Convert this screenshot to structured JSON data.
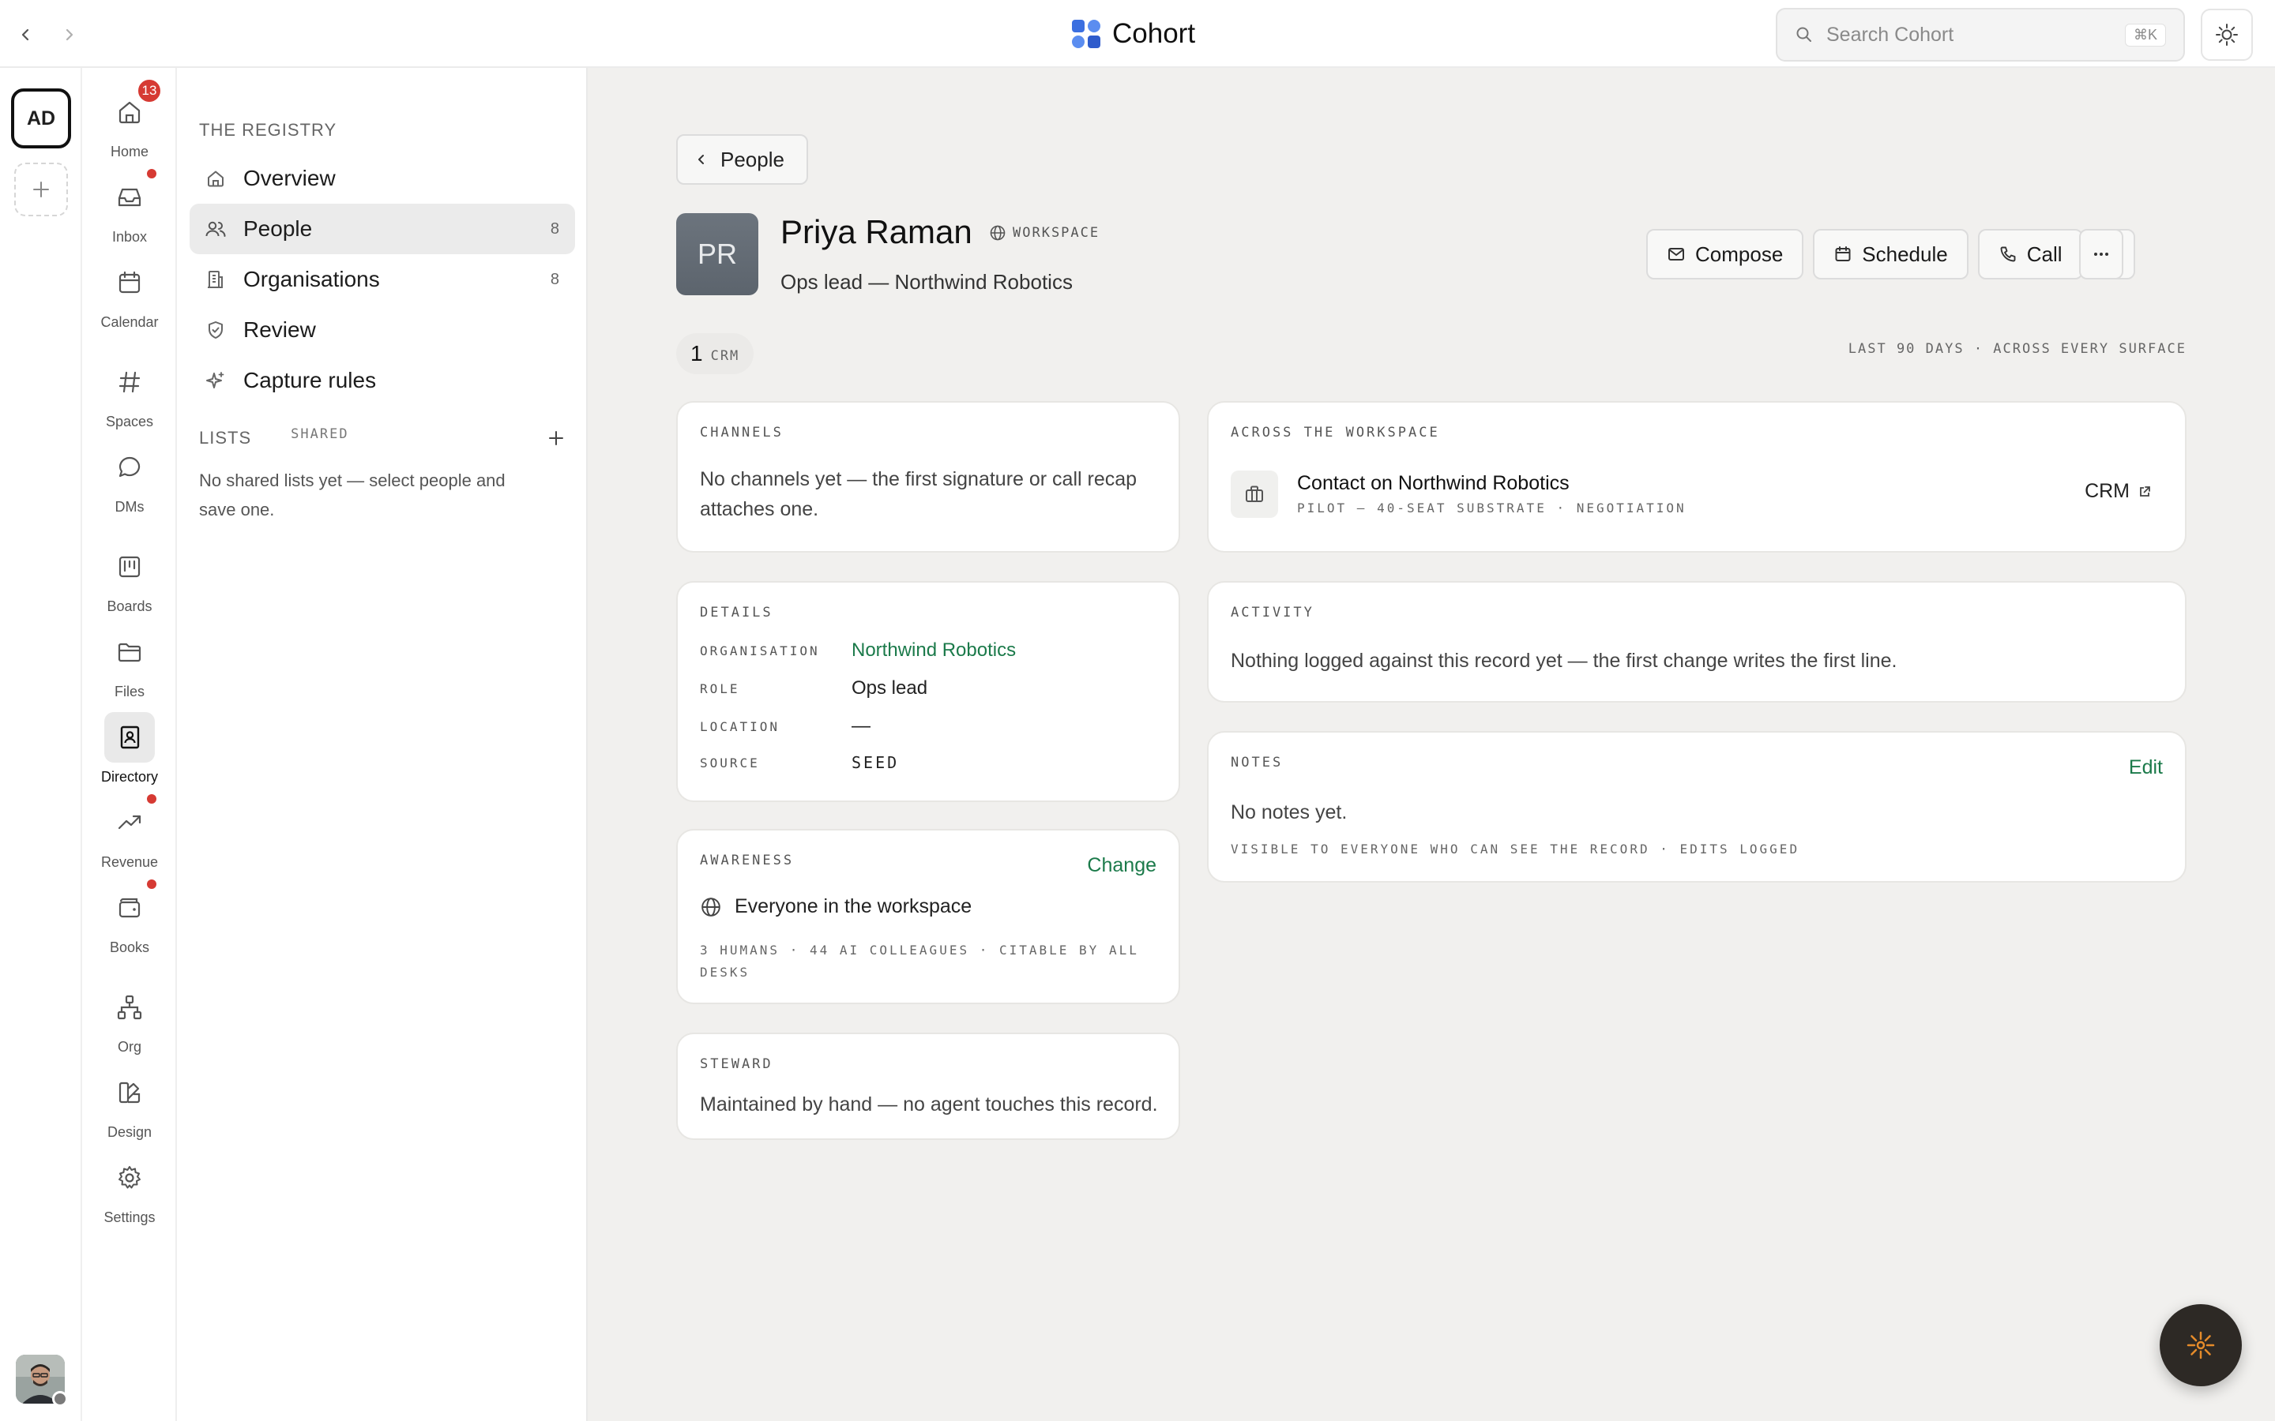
{
  "topbar": {
    "app_name": "Cohort",
    "search_placeholder": "Search Cohort",
    "search_shortcut": "⌘K"
  },
  "workspace_rail": {
    "current_initials": "AD"
  },
  "app_rail": {
    "items": [
      {
        "label": "Home",
        "icon": "home-icon",
        "badge": "13"
      },
      {
        "label": "Inbox",
        "icon": "inbox-icon",
        "dot": true
      },
      {
        "label": "Calendar",
        "icon": "calendar-icon"
      },
      {
        "label": "Spaces",
        "icon": "hash-icon"
      },
      {
        "label": "DMs",
        "icon": "chat-bubble-icon"
      },
      {
        "label": "Boards",
        "icon": "kanban-icon"
      },
      {
        "label": "Files",
        "icon": "folder-icon"
      },
      {
        "label": "Directory",
        "icon": "contact-book-icon",
        "active": true
      },
      {
        "label": "Revenue",
        "icon": "trend-up-icon",
        "dot": true
      },
      {
        "label": "Books",
        "icon": "wallet-icon",
        "dot": true
      },
      {
        "label": "Org",
        "icon": "org-chart-icon"
      },
      {
        "label": "Design",
        "icon": "palette-icon"
      },
      {
        "label": "Settings",
        "icon": "gear-icon"
      }
    ]
  },
  "sidebar": {
    "section_title": "THE REGISTRY",
    "items": [
      {
        "label": "Overview",
        "count": "",
        "icon": "home-icon"
      },
      {
        "label": "People",
        "count": "8",
        "icon": "people-icon",
        "active": true
      },
      {
        "label": "Organisations",
        "count": "8",
        "icon": "building-icon"
      },
      {
        "label": "Review",
        "count": "",
        "icon": "shield-check-icon"
      },
      {
        "label": "Capture rules",
        "count": "",
        "icon": "sparkle-icon"
      }
    ],
    "lists_title": "LISTS",
    "lists_filter": "SHARED",
    "lists_empty": "No shared lists yet — select people and save one."
  },
  "record": {
    "back_label": "People",
    "avatar_initials": "PR",
    "name": "Priya Raman",
    "scope_tag": "WORKSPACE",
    "subtitle": "Ops lead — Northwind Robotics",
    "actions": {
      "compose": "Compose",
      "schedule": "Schedule",
      "call": "Call"
    },
    "crm_count": "1",
    "crm_label": "CRM",
    "range_note": "LAST 90 DAYS · ACROSS EVERY SURFACE"
  },
  "cards": {
    "channels": {
      "label": "CHANNELS",
      "text": "No channels yet — the first signature or call recap attaches one."
    },
    "details": {
      "label": "DETAILS",
      "rows": [
        {
          "key": "ORGANISATION",
          "value": "Northwind Robotics"
        },
        {
          "key": "ROLE",
          "value": "Ops lead"
        },
        {
          "key": "LOCATION",
          "value": "—"
        },
        {
          "key": "SOURCE",
          "value": "SEED"
        }
      ]
    },
    "awareness": {
      "label": "AWARENESS",
      "change_label": "Change",
      "audience": "Everyone in the workspace",
      "meta": "3 HUMANS · 44 AI COLLEAGUES · CITABLE BY ALL DESKS"
    },
    "steward": {
      "label": "STEWARD",
      "text": "Maintained by hand — no agent touches this record."
    },
    "workspace": {
      "label": "ACROSS THE WORKSPACE",
      "item_title": "Contact on Northwind Robotics",
      "item_meta": "PILOT — 40-SEAT SUBSTRATE · NEGOTIATION",
      "item_link": "CRM"
    },
    "activity": {
      "label": "ACTIVITY",
      "text": "Nothing logged against this record yet — the first change writes the first line."
    },
    "notes": {
      "label": "NOTES",
      "edit_label": "Edit",
      "text": "No notes yet.",
      "meta": "VISIBLE TO EVERYONE WHO CAN SEE THE RECORD · EDITS LOGGED"
    }
  },
  "colors": {
    "accent_green": "#1b7a4a",
    "badge_red": "#d63a33",
    "logo_blue": "#3b6fe0",
    "fab_orange": "#e58b2a"
  }
}
